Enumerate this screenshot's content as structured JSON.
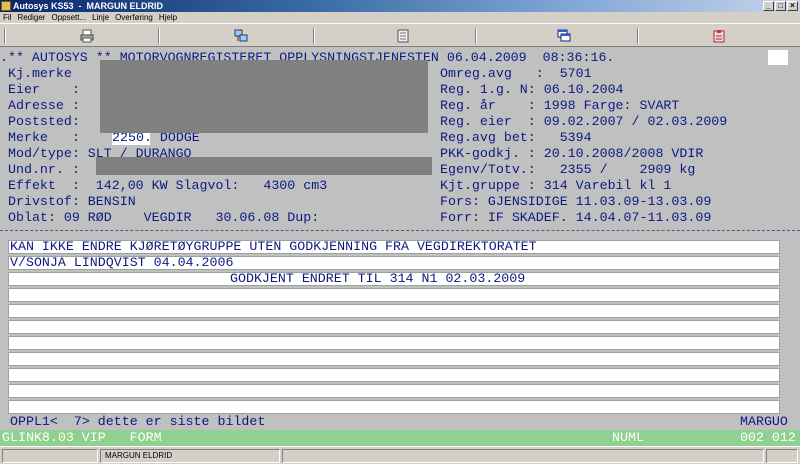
{
  "window": {
    "title": "Autosys KS53  -  MARGUN ELDRID",
    "minimize": "_",
    "maximize": "□",
    "close": "×"
  },
  "menu": [
    "Fil",
    "Rediger",
    "Oppsett...",
    "Linje",
    "Overføring",
    "Hjelp"
  ],
  "toolbar_icons": [
    "print-icon",
    "network-icon",
    "document-icon",
    "windows-icon",
    "clipboard-icon"
  ],
  "screen": {
    "header": ".** AUTOSYS ** MOTORVOGNREGISTERET OPPLYSNINGSTJENESTEN 06.04.2009  08:36:16.",
    "left": {
      "kjmerke": "Kj.merke",
      "eier": "Eier    :",
      "adresse": "Adresse :",
      "poststed": "Poststed:",
      "merke_label": "Merke   :",
      "merke_value": "2250. DODGE",
      "modtype": "Mod/type: SLT / DURANGO",
      "undnr": "Und.nr. :",
      "effekt": "Effekt  :  142,00 KW Slagvol:   4300 cm3",
      "drivstoff": "Drivstof: BENSIN",
      "oblat": "Oblat: 09 RØD    VEGDIR   30.06.08 Dup:"
    },
    "right": {
      "omreg": "Omreg.avg   :  5701",
      "reg1g": "Reg. 1.g. N: 06.10.2004",
      "regar": "Reg. år    : 1998 Farge: SVART",
      "regeier": "Reg. eier  : 09.02.2007 / 02.03.2009",
      "regavg": "Reg.avg bet:   5394",
      "pkk": "PKK-godkj. : 20.10.2008/2008 VDIR",
      "egenv": "Egenv/Totv.:   2355 /    2909 kg",
      "kjtgruppe": "Kjt.gruppe : 314 Varebil kl 1",
      "fors": "Fors: GJENSIDIGE 11.03.09-13.03.09",
      "forr": "Forr: IF SKADEF. 14.04.07-11.03.09"
    },
    "notes": [
      "KAN IKKE ENDRE KJØRETØYGRUPPE UTEN GODKJENNING FRA VEGDIREKTORATET",
      "V/SONJA LINDQVIST 04.04.2006",
      "GODKJENT ENDRET TIL 314 N1 02.03.2009"
    ],
    "footer_left": "OPPL1<  7> dette er siste bildet",
    "footer_right": "MARGUO"
  },
  "status": {
    "left": "GLINK8.03 VIP   FORM",
    "mode": "NUML",
    "pos": "002 012"
  },
  "winstatus": {
    "user": "MARGUN ELDRID"
  }
}
